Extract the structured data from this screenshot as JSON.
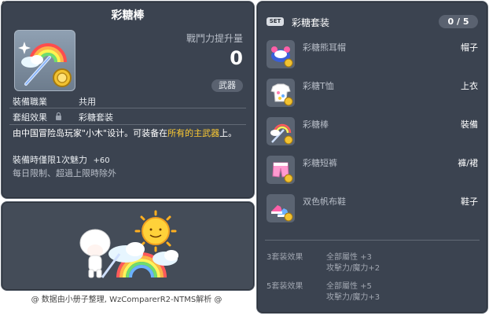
{
  "item_id": "01702509",
  "item": {
    "name": "彩糖棒",
    "power_label": "戰鬥力提升量",
    "power_value": "0",
    "category_badge": "武器",
    "job_label": "裝備職業",
    "job_value": "共用",
    "set_label": "套組效果",
    "set_value": "彩糖套装",
    "desc_part1": "由中国冒险岛玩家\"小木\"设计。可装备在",
    "desc_highlight": "所有的主武器",
    "desc_part2": "上。",
    "bonus_label": "裝備時僅限1次魅力",
    "bonus_value": "+60",
    "limit_text": "每日限制、超過上限時除外"
  },
  "footer": "@ 数据由小册子整理, WzComparerR2-NTMS解析 @",
  "set": {
    "badge": "SET",
    "title": "彩糖套装",
    "count": "0 / 5",
    "items": [
      {
        "name": "彩糖熊耳帽",
        "slot": "帽子"
      },
      {
        "name": "彩糖T恤",
        "slot": "上衣"
      },
      {
        "name": "彩糖棒",
        "slot": "裝備"
      },
      {
        "name": "彩糖短裤",
        "slot": "褲/裙"
      },
      {
        "name": "双色帆布鞋",
        "slot": "鞋子"
      }
    ],
    "effects": [
      {
        "label": "3套装效果",
        "line1": "全部屬性 +3",
        "line2": "攻擊力/魔力+2"
      },
      {
        "label": "5套装效果",
        "line1": "全部屬性 +5",
        "line2": "攻擊力/魔力+3"
      }
    ]
  }
}
